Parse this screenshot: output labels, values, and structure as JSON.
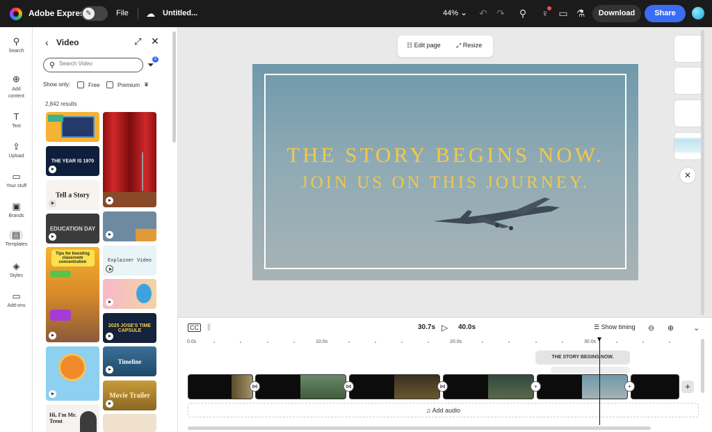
{
  "topbar": {
    "app_title": "Adobe Express",
    "file_label": "File",
    "doc_title": "Untitled...",
    "zoom": "44%",
    "download_label": "Download",
    "share_label": "Share",
    "accent_color": "#3a6cf4"
  },
  "rail": {
    "items": [
      {
        "label": "Search",
        "icon": "search-icon"
      },
      {
        "label": "Add content",
        "icon": "plus-circle-icon"
      },
      {
        "label": "Text",
        "icon": "text-icon"
      },
      {
        "label": "Upload",
        "icon": "upload-icon"
      },
      {
        "label": "Your stuff",
        "icon": "folder-icon"
      },
      {
        "label": "Brands",
        "icon": "brand-icon"
      },
      {
        "label": "Templates",
        "icon": "templates-icon"
      },
      {
        "label": "Styles",
        "icon": "styles-icon"
      },
      {
        "label": "Add-ons",
        "icon": "addons-icon"
      }
    ]
  },
  "panel": {
    "title": "Video",
    "search_placeholder": "Search Video",
    "filter_badge": "2",
    "show_only": "Show only:",
    "free_label": "Free",
    "premium_label": "Premium",
    "results": "2,842 results",
    "thumbnails": [
      {
        "label": ""
      },
      {
        "label": ""
      },
      {
        "label": "THE YEAR IS 1970"
      },
      {
        "label": "Tell a Story"
      },
      {
        "label": "EDUCATION DAY"
      },
      {
        "label": ""
      },
      {
        "label": "Tips for boosting classroom concentration"
      },
      {
        "label": "Explainer Video"
      },
      {
        "label": ""
      },
      {
        "label": "2025 JOSE'S TIME CAPSULE"
      },
      {
        "label": ""
      },
      {
        "label": "Timeline"
      },
      {
        "label": "Movie Trailer"
      },
      {
        "label": "Hi, I'm Mr. Trent"
      },
      {
        "label": ""
      }
    ]
  },
  "canvas": {
    "edit_page_label": "Edit page",
    "resize_label": "Resize",
    "slide_line1": "THE STORY BEGINS NOW.",
    "slide_line2": "JOIN US ON THIS JOURNEY."
  },
  "timeline": {
    "current_time": "30.7s",
    "total_time": "40.0s",
    "show_timing_label": "Show timing",
    "ruler": [
      "0.0s",
      "10.0s",
      "20.0s",
      "30.0s"
    ],
    "text_track_label": "THE STORY BEGINS NOW.",
    "add_audio_label": "Add audio"
  }
}
